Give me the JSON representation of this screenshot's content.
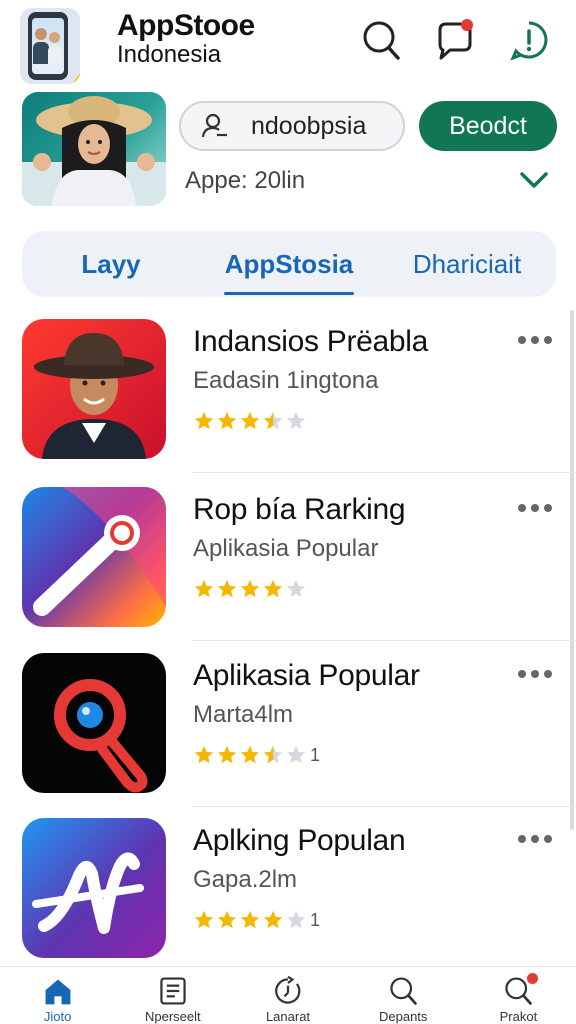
{
  "header": {
    "title": "AppStooe",
    "subtitle": "Indonesia",
    "icons": [
      "search-icon",
      "chat-icon",
      "alert-icon"
    ],
    "notification_color": "#e53935"
  },
  "profile": {
    "search_value": "ndoobpsia",
    "button_label": "Beodct",
    "count_text": "Appe: 20lin"
  },
  "tabs": [
    {
      "label": "Layy"
    },
    {
      "label": "AppStosia"
    },
    {
      "label": "Dhariciait"
    }
  ],
  "apps": [
    {
      "name": "Indansios Prëabla",
      "sub": "Eadasin 1ingtona",
      "rating": 3.5,
      "count": ""
    },
    {
      "name": "Rop bía Rarking",
      "sub": "Aplikasia Popular",
      "rating": 4,
      "count": ""
    },
    {
      "name": "Aplikasia Popular",
      "sub": "Marta4lm",
      "rating": 3.5,
      "count": "1"
    },
    {
      "name": "Aplking Populan",
      "sub": "Gapa.2lm",
      "rating": 4,
      "count": "1"
    }
  ],
  "bottom_nav": [
    {
      "label": "Jioto",
      "icon": "home-icon"
    },
    {
      "label": "Nperseelt",
      "icon": "news-icon"
    },
    {
      "label": "Lanarat",
      "icon": "update-icon"
    },
    {
      "label": "Depants",
      "icon": "search-icon"
    },
    {
      "label": "Prakot",
      "icon": "search-icon"
    }
  ],
  "colors": {
    "accent_blue": "#1767b5",
    "primary_green": "#107654",
    "star": "#f5b800",
    "star_empty": "#d5d8dc"
  }
}
